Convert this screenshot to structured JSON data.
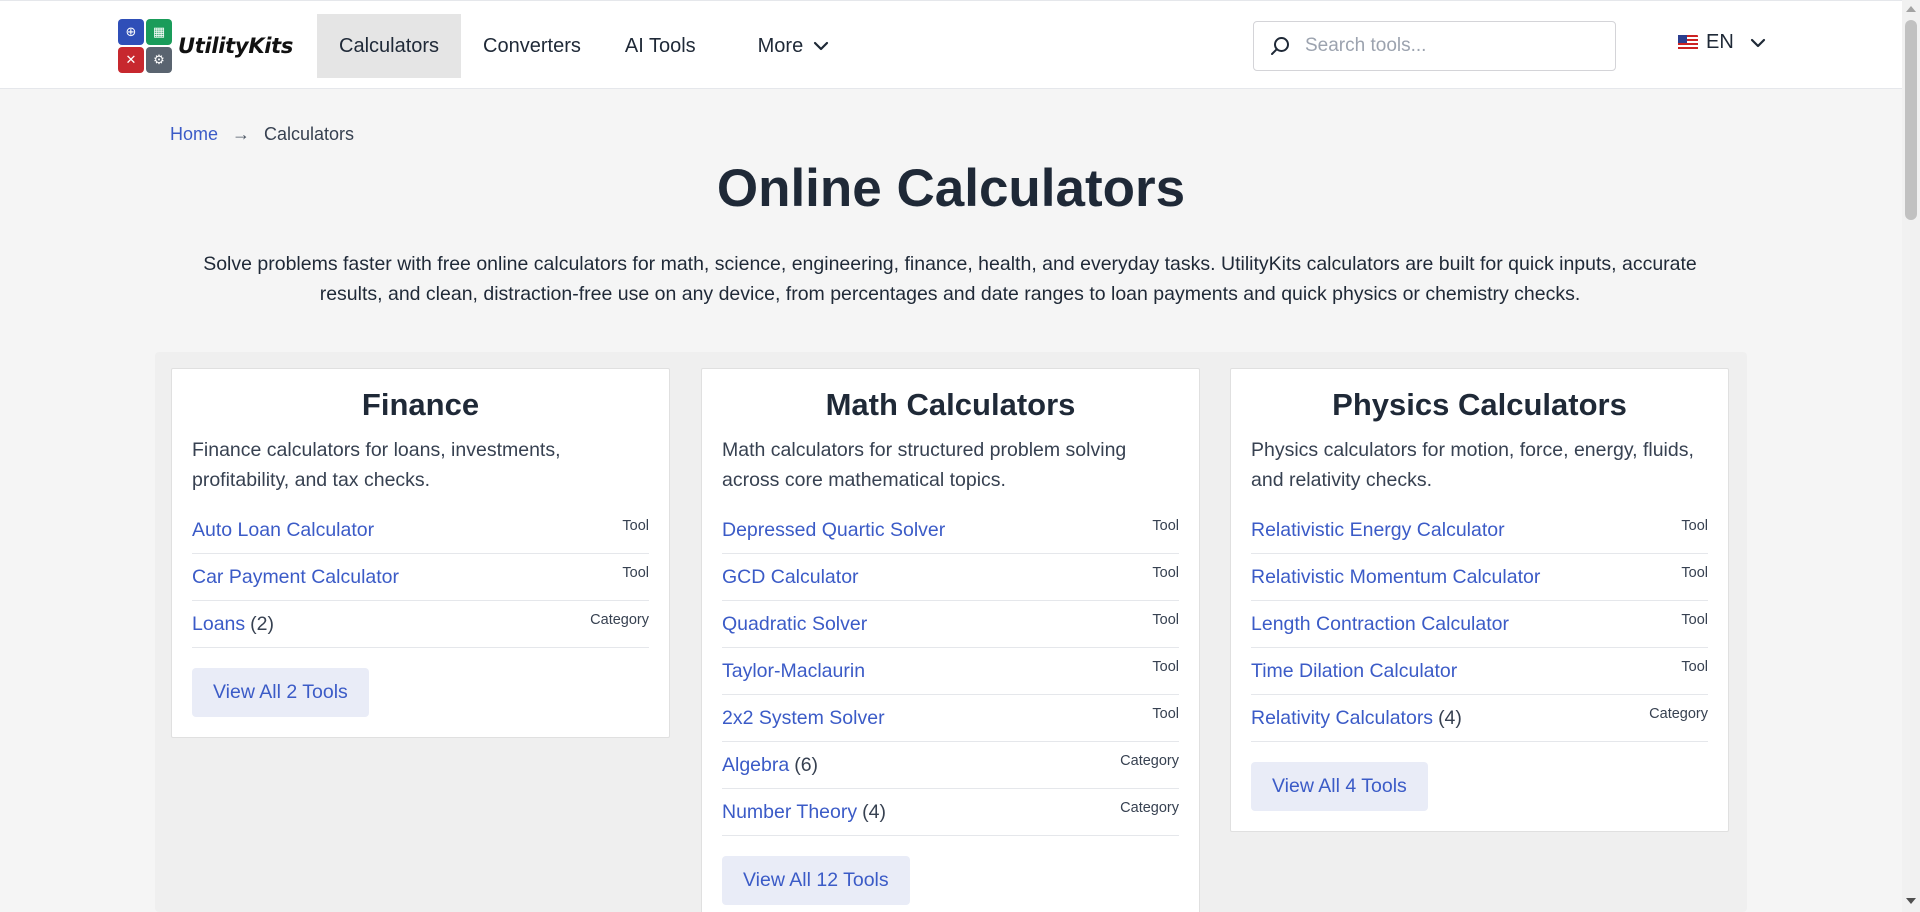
{
  "header": {
    "logo_text": "UtilityKits",
    "nav": [
      {
        "label": "Calculators"
      },
      {
        "label": "Converters"
      },
      {
        "label": "AI Tools"
      },
      {
        "label": "More"
      }
    ],
    "search_placeholder": "Search tools...",
    "language": "EN"
  },
  "breadcrumb": {
    "home": "Home",
    "separator": "→",
    "current": "Calculators"
  },
  "page_title": "Online Calculators",
  "intro": "Solve problems faster with free online calculators for math, science, engineering, finance, health, and everyday tasks. UtilityKits calculators are built for quick inputs, accurate results, and clean, distraction-free use on any device, from percentages and date ranges to loan payments and quick physics or chemistry checks.",
  "cards": [
    {
      "title": "Finance",
      "description": "Finance calculators for loans, investments, profitability, and tax checks.",
      "items": [
        {
          "name": "Auto Loan Calculator",
          "count": "",
          "tag": "Tool"
        },
        {
          "name": "Car Payment Calculator",
          "count": "",
          "tag": "Tool"
        },
        {
          "name": "Loans",
          "count": "(2)",
          "tag": "Category"
        }
      ],
      "button": "View All 2 Tools"
    },
    {
      "title": "Math Calculators",
      "description": "Math calculators for structured problem solving across core mathematical topics.",
      "items": [
        {
          "name": "Depressed Quartic Solver",
          "count": "",
          "tag": "Tool"
        },
        {
          "name": "GCD Calculator",
          "count": "",
          "tag": "Tool"
        },
        {
          "name": "Quadratic Solver",
          "count": "",
          "tag": "Tool"
        },
        {
          "name": "Taylor-Maclaurin",
          "count": "",
          "tag": "Tool"
        },
        {
          "name": "2x2 System Solver",
          "count": "",
          "tag": "Tool"
        },
        {
          "name": "Algebra",
          "count": "(6)",
          "tag": "Category"
        },
        {
          "name": "Number Theory",
          "count": "(4)",
          "tag": "Category"
        }
      ],
      "button": "View All 12 Tools"
    },
    {
      "title": "Physics Calculators",
      "description": "Physics calculators for motion, force, energy, fluids, and relativity checks.",
      "items": [
        {
          "name": "Relativistic Energy Calculator",
          "count": "",
          "tag": "Tool"
        },
        {
          "name": "Relativistic Momentum Calculator",
          "count": "",
          "tag": "Tool"
        },
        {
          "name": "Length Contraction Calculator",
          "count": "",
          "tag": "Tool"
        },
        {
          "name": "Time Dilation Calculator",
          "count": "",
          "tag": "Tool"
        },
        {
          "name": "Relativity Calculators",
          "count": "(4)",
          "tag": "Category"
        }
      ],
      "button": "View All 4 Tools"
    }
  ]
}
